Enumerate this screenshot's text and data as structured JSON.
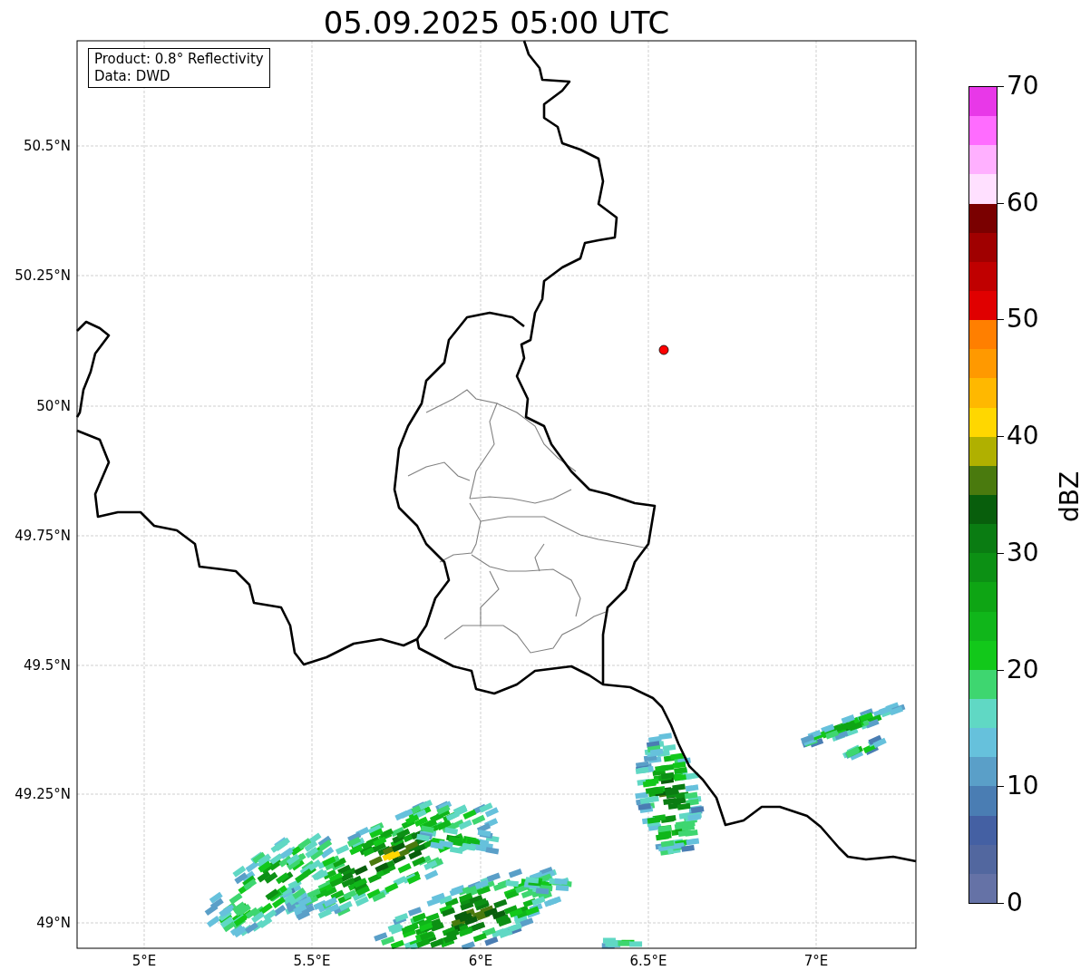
{
  "title": "05.09.2025 05:00 UTC",
  "info_box": {
    "lines": [
      "Product: 0.8° Reflectivity",
      "Data: DWD"
    ]
  },
  "map": {
    "lat_labels": [
      "50.5°N",
      "50.25°N",
      "50°N",
      "49.75°N",
      "49.5°N",
      "49.25°N",
      "49°N"
    ],
    "lon_labels": [
      "5°E",
      "5.5°E",
      "6°E",
      "6.5°E",
      "7°E"
    ],
    "marker": {
      "color": "#ff0000"
    }
  },
  "colorbar": {
    "label": "dBZ",
    "ticks": [
      "70",
      "60",
      "50",
      "40",
      "30",
      "20",
      "10",
      "0"
    ],
    "segments": [
      {
        "color": "#e838e8"
      },
      {
        "color": "#ff6cff"
      },
      {
        "color": "#ffb0ff"
      },
      {
        "color": "#ffe0ff"
      },
      {
        "color": "#7a0000"
      },
      {
        "color": "#a00000"
      },
      {
        "color": "#c00000"
      },
      {
        "color": "#e00000"
      },
      {
        "color": "#ff7f00"
      },
      {
        "color": "#ff9900"
      },
      {
        "color": "#ffb800"
      },
      {
        "color": "#ffd700"
      },
      {
        "color": "#b0b000"
      },
      {
        "color": "#4a7a0e"
      },
      {
        "color": "#085e0c"
      },
      {
        "color": "#0a7c12"
      },
      {
        "color": "#0c9014"
      },
      {
        "color": "#0ea514"
      },
      {
        "color": "#10b61a"
      },
      {
        "color": "#12c81a"
      },
      {
        "color": "#3ed670"
      },
      {
        "color": "#60d8c4"
      },
      {
        "color": "#66c1dc"
      },
      {
        "color": "#5a9fc8"
      },
      {
        "color": "#4a7db3"
      },
      {
        "color": "#4460a3"
      },
      {
        "color": "#52679f"
      },
      {
        "color": "#6572a6"
      }
    ]
  }
}
